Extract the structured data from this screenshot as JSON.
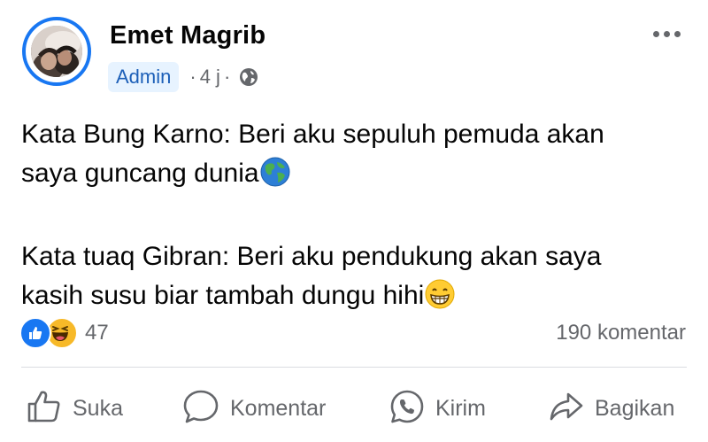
{
  "post": {
    "author": "Emet Magrib",
    "badge": "Admin",
    "time": "4 j",
    "separator": "·",
    "text_para1_line1": "Kata Bung Karno: Beri aku sepuluh pemuda akan",
    "text_para1_line2": "saya guncang dunia",
    "text_para2_line1": "Kata tuaq Gibran: Beri aku pendukung akan saya",
    "text_para2_line2": "kasih susu biar tambah dungu hihi",
    "emoji_1": "globe-emoji",
    "emoji_2": "grinning-emoji"
  },
  "reactions": {
    "types": [
      "like",
      "haha"
    ],
    "count": "47",
    "comments": "190 komentar"
  },
  "actions": [
    {
      "label": "Suka",
      "icon": "thumbs-up-icon"
    },
    {
      "label": "Komentar",
      "icon": "comment-icon"
    },
    {
      "label": "Kirim",
      "icon": "whatsapp-icon"
    },
    {
      "label": "Bagikan",
      "icon": "share-icon"
    }
  ],
  "colors": {
    "accent": "#1877f2",
    "text": "#050505",
    "secondary_text": "#65676b",
    "badge_bg": "#e7f3ff",
    "badge_text": "#1c5fb8",
    "divider": "#dadde1"
  }
}
